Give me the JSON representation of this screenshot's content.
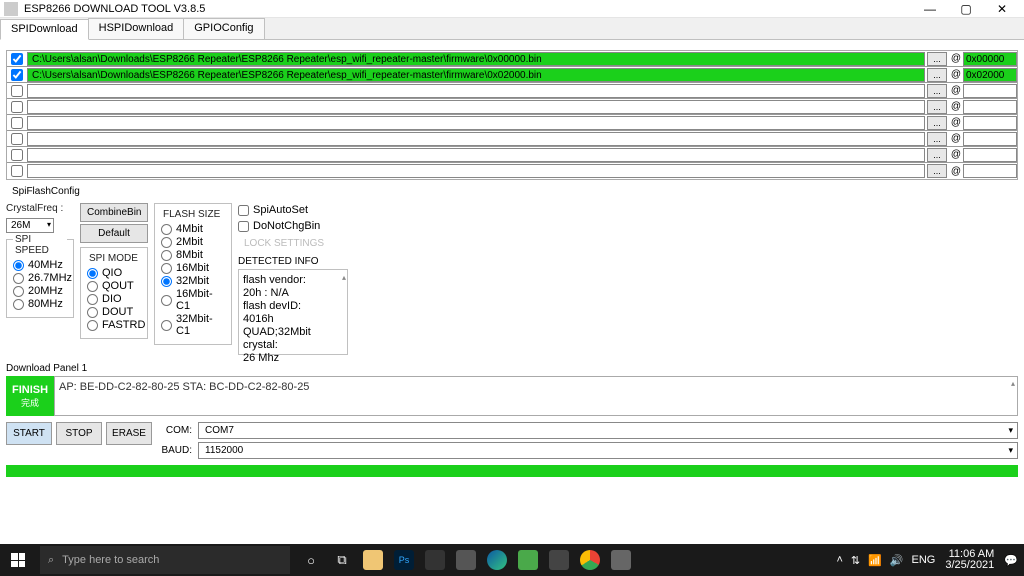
{
  "window": {
    "title": "ESP8266 DOWNLOAD TOOL V3.8.5"
  },
  "tabs": [
    "SPIDownload",
    "HSPIDownload",
    "GPIOConfig"
  ],
  "active_tab": 0,
  "file_rows": [
    {
      "checked": true,
      "path": "C:\\Users\\alsan\\Downloads\\ESP8266 Repeater\\ESP8266 Repeater\\esp_wifi_repeater-master\\firmware\\0x00000.bin",
      "addr": "0x00000",
      "green": true
    },
    {
      "checked": true,
      "path": "C:\\Users\\alsan\\Downloads\\ESP8266 Repeater\\ESP8266 Repeater\\esp_wifi_repeater-master\\firmware\\0x02000.bin",
      "addr": "0x02000",
      "green": true
    },
    {
      "checked": false,
      "path": "",
      "addr": "",
      "green": false
    },
    {
      "checked": false,
      "path": "",
      "addr": "",
      "green": false
    },
    {
      "checked": false,
      "path": "",
      "addr": "",
      "green": false
    },
    {
      "checked": false,
      "path": "",
      "addr": "",
      "green": false
    },
    {
      "checked": false,
      "path": "",
      "addr": "",
      "green": false
    },
    {
      "checked": false,
      "path": "",
      "addr": "",
      "green": false
    }
  ],
  "spi_flash_config_label": "SpiFlashConfig",
  "crystal": {
    "label": "CrystalFreq :",
    "value": "26M"
  },
  "btn_combine": "CombineBin",
  "btn_default": "Default",
  "spi_speed": {
    "title": "SPI SPEED",
    "options": [
      "40MHz",
      "26.7MHz",
      "20MHz",
      "80MHz"
    ],
    "selected": "40MHz"
  },
  "spi_mode": {
    "title": "SPI MODE",
    "options": [
      "QIO",
      "QOUT",
      "DIO",
      "DOUT",
      "FASTRD"
    ],
    "selected": "QIO"
  },
  "flash_size": {
    "title": "FLASH SIZE",
    "options": [
      "4Mbit",
      "2Mbit",
      "8Mbit",
      "16Mbit",
      "32Mbit",
      "16Mbit-C1",
      "32Mbit-C1"
    ],
    "selected": "32Mbit"
  },
  "checks": {
    "spi_auto": "SpiAutoSet",
    "do_not_chg": "DoNotChgBin",
    "lock": "LOCK SETTINGS"
  },
  "detected": {
    "title": "DETECTED INFO",
    "lines": "flash vendor:\n20h : N/A\nflash devID:\n4016h\nQUAD;32Mbit\ncrystal:\n26 Mhz"
  },
  "download_panel_label": "Download Panel 1",
  "finish": {
    "label": "FINISH",
    "sub": "完成"
  },
  "msg": "AP:  BE-DD-C2-82-80-25  STA:  BC-DD-C2-82-80-25",
  "ctrl": {
    "start": "START",
    "stop": "STOP",
    "erase": "ERASE",
    "com_label": "COM:",
    "com_value": "COM7",
    "baud_label": "BAUD:",
    "baud_value": "1152000"
  },
  "taskbar": {
    "search_placeholder": "Type here to search",
    "lang": "ENG",
    "time": "11:06 AM",
    "date": "3/25/2021"
  }
}
